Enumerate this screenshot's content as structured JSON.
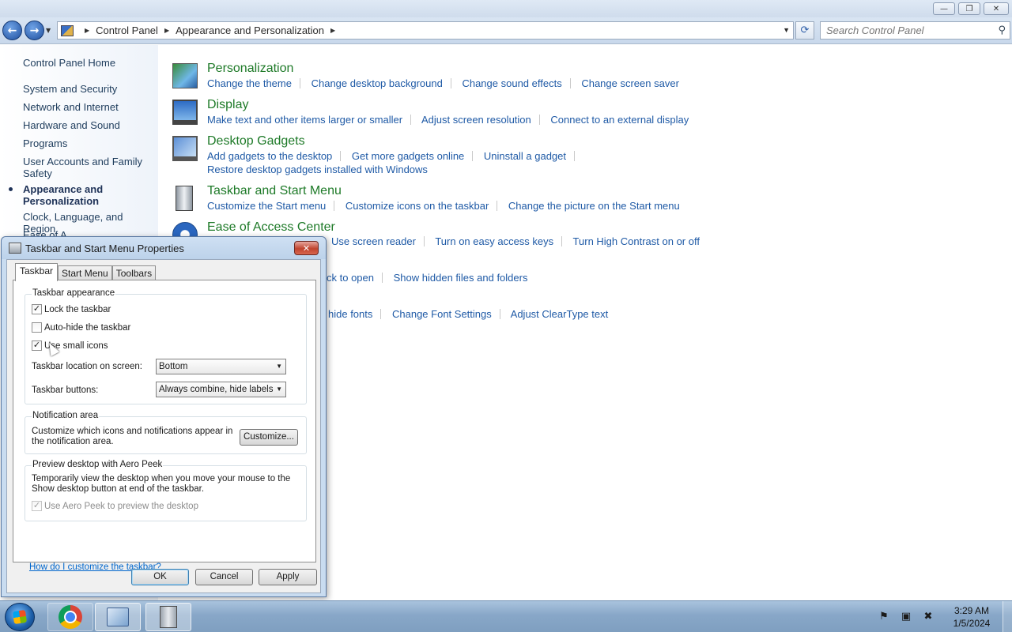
{
  "window": {
    "controls": {
      "minimize": "—",
      "restore": "❐",
      "close": "✕"
    }
  },
  "address_bar": {
    "crumbs": [
      "Control Panel",
      "Appearance and Personalization"
    ],
    "search_placeholder": "Search Control Panel"
  },
  "sidebar": {
    "items": [
      {
        "label": "Control Panel Home"
      },
      {
        "label": "System and Security"
      },
      {
        "label": "Network and Internet"
      },
      {
        "label": "Hardware and Sound"
      },
      {
        "label": "Programs"
      },
      {
        "label": "User Accounts and Family Safety"
      },
      {
        "label": "Appearance and Personalization",
        "active": true
      },
      {
        "label": "Clock, Language, and Region"
      },
      {
        "label": "Ease of A..."
      }
    ]
  },
  "categories": [
    {
      "title": "Personalization",
      "links": [
        "Change the theme",
        "Change desktop background",
        "Change sound effects",
        "Change screen saver"
      ]
    },
    {
      "title": "Display",
      "links": [
        "Make text and other items larger or smaller",
        "Adjust screen resolution",
        "Connect to an external display"
      ]
    },
    {
      "title": "Desktop Gadgets",
      "links": [
        "Add gadgets to the desktop",
        "Get more gadgets online",
        "Uninstall a gadget"
      ],
      "links2": [
        "Restore desktop gadgets installed with Windows"
      ]
    },
    {
      "title": "Taskbar and Start Menu",
      "links": [
        "Customize the Start menu",
        "Customize icons on the taskbar",
        "Change the picture on the Start menu"
      ]
    },
    {
      "title": "Ease of Access Center",
      "links": [
        "Use screen reader",
        "Turn on easy access keys",
        "Turn High Contrast on or off"
      ]
    }
  ],
  "folder_partial": {
    "links": [
      "ck to open",
      "Show hidden files and folders"
    ]
  },
  "fonts_partial": {
    "links": [
      "hide fonts",
      "Change Font Settings",
      "Adjust ClearType text"
    ]
  },
  "dialog": {
    "title": "Taskbar and Start Menu Properties",
    "tabs": [
      "Taskbar",
      "Start Menu",
      "Toolbars"
    ],
    "active_tab": "Taskbar",
    "appearance": {
      "title": "Taskbar appearance",
      "lock": {
        "label": "Lock the taskbar",
        "checked": true
      },
      "autohide": {
        "label": "Auto-hide the taskbar",
        "checked": false
      },
      "small_icons": {
        "label": "Use small icons",
        "checked": true
      },
      "location_label": "Taskbar location on screen:",
      "location_value": "Bottom",
      "buttons_label": "Taskbar buttons:",
      "buttons_value": "Always combine, hide labels"
    },
    "notification": {
      "title": "Notification area",
      "text": "Customize which icons and notifications appear in the notification area.",
      "button": "Customize..."
    },
    "aero_peek": {
      "title": "Preview desktop with Aero Peek",
      "text": "Temporarily view the desktop when you move your mouse to the Show desktop button at end of the taskbar.",
      "checkbox": {
        "label": "Use Aero Peek to preview the desktop",
        "checked": true,
        "disabled": true
      }
    },
    "help_link": "How do I customize the taskbar?",
    "buttons": {
      "ok": "OK",
      "cancel": "Cancel",
      "apply": "Apply"
    }
  },
  "taskbar": {
    "time": "3:29 AM",
    "date": "1/5/2024"
  }
}
